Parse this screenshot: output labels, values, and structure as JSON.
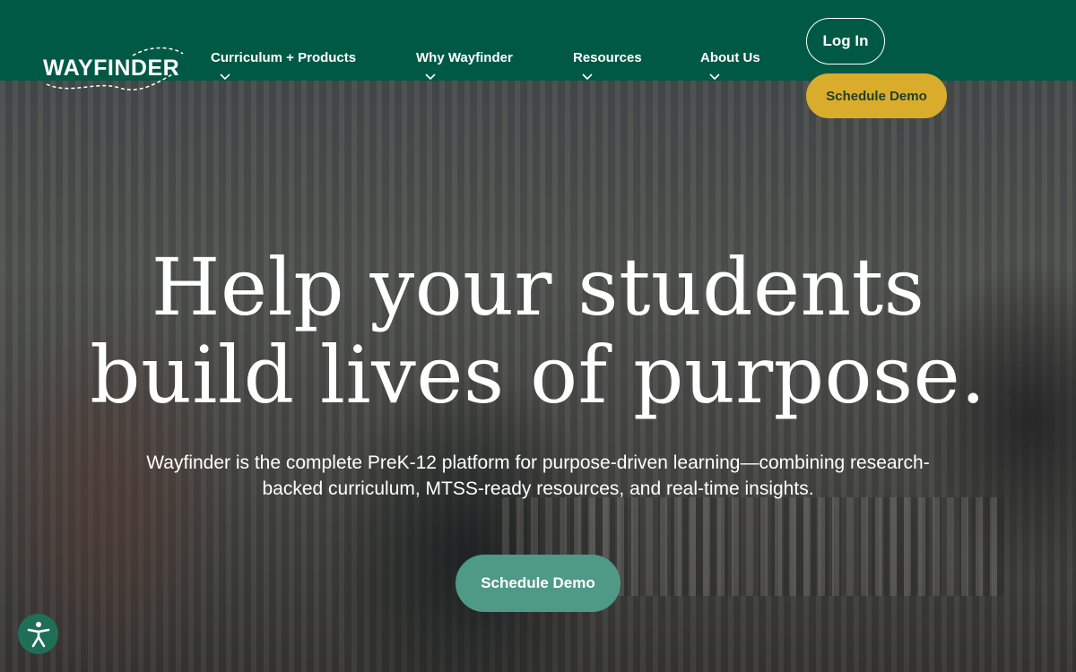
{
  "header": {
    "logo_text": "WAYFINDER",
    "nav": [
      {
        "label": "Curriculum + Products"
      },
      {
        "label": "Why Wayfinder"
      },
      {
        "label": "Resources"
      },
      {
        "label": "About Us"
      }
    ],
    "login_label": "Log In",
    "demo_label": "Schedule Demo"
  },
  "hero": {
    "title_line1": "Help your students",
    "title_line2": "build lives of purpose.",
    "subtitle": "Wayfinder is the complete PreK-12 platform for purpose-driven learning—combining research-backed curriculum, MTSS-ready resources, and real-time insights.",
    "cta_label": "Schedule Demo"
  },
  "accessibility": {
    "icon": "accessibility-icon"
  },
  "colors": {
    "header_bg": "#005945",
    "demo_top_bg": "#d9ad2b",
    "demo_hero_bg": "#4e9a87"
  }
}
